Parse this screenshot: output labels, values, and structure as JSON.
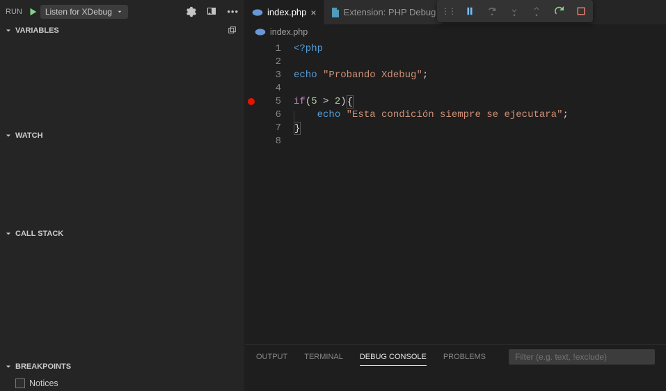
{
  "run": {
    "label": "RUN",
    "config": "Listen for XDebug"
  },
  "panels": {
    "variables": "VARIABLES",
    "watch": "WATCH",
    "callstack": "CALL STACK",
    "breakpoints": "BREAKPOINTS"
  },
  "breakpoints": {
    "items": [
      "Notices"
    ]
  },
  "tabs": {
    "file": "index.php",
    "ext": "Extension: PHP Debug"
  },
  "breadcrumb": {
    "file": "index.php"
  },
  "editor": {
    "lines": [
      {
        "n": 1,
        "bp": false
      },
      {
        "n": 2,
        "bp": false
      },
      {
        "n": 3,
        "bp": false
      },
      {
        "n": 4,
        "bp": false
      },
      {
        "n": 5,
        "bp": true
      },
      {
        "n": 6,
        "bp": false
      },
      {
        "n": 7,
        "bp": false
      },
      {
        "n": 8,
        "bp": false
      }
    ],
    "tokens": {
      "php_open": "<?php",
      "echo": "echo",
      "str1": "\"Probando Xdebug\"",
      "if": "if",
      "cond_open": "(",
      "five": "5",
      "gt": ">",
      "two": "2",
      "cond_close": ")",
      "brace_open": "{",
      "str2": "\"Esta condición siempre se ejecutara\"",
      "brace_close": "}",
      "semi": ";"
    }
  },
  "bottomPanel": {
    "tabs": [
      "OUTPUT",
      "TERMINAL",
      "DEBUG CONSOLE",
      "PROBLEMS"
    ],
    "active": 2,
    "filterPlaceholder": "Filter (e.g. text, !exclude)"
  }
}
